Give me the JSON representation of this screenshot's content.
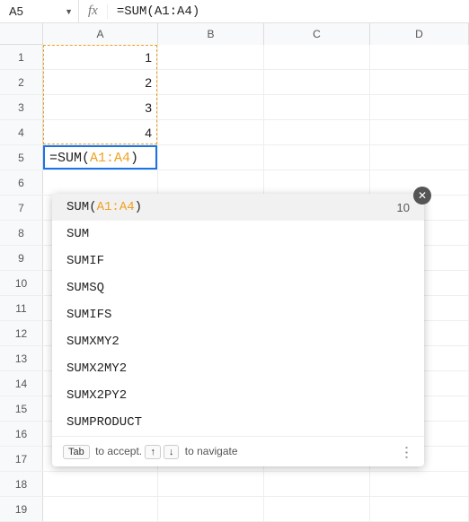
{
  "nameBox": "A5",
  "formulaBar": "=SUM(A1:A4)",
  "columns": [
    "A",
    "B",
    "C",
    "D"
  ],
  "rowCount": 19,
  "cells": {
    "A1": "1",
    "A2": "2",
    "A3": "3",
    "A4": "4"
  },
  "activeCell": {
    "eq": "=",
    "fn": "SUM(",
    "rng": "A1:A4",
    "close": ")"
  },
  "autocomplete": {
    "top": {
      "prefix": "SUM(",
      "rng": "A1:A4",
      "suffix": ")",
      "preview": "10"
    },
    "items": [
      "SUM",
      "SUMIF",
      "SUMSQ",
      "SUMIFS",
      "SUMXMY2",
      "SUMX2MY2",
      "SUMX2PY2",
      "SUMPRODUCT"
    ],
    "footer": {
      "tabKey": "Tab",
      "tabText": " to accept. ",
      "upKey": "↑",
      "downKey": "↓",
      "navText": " to navigate"
    }
  }
}
